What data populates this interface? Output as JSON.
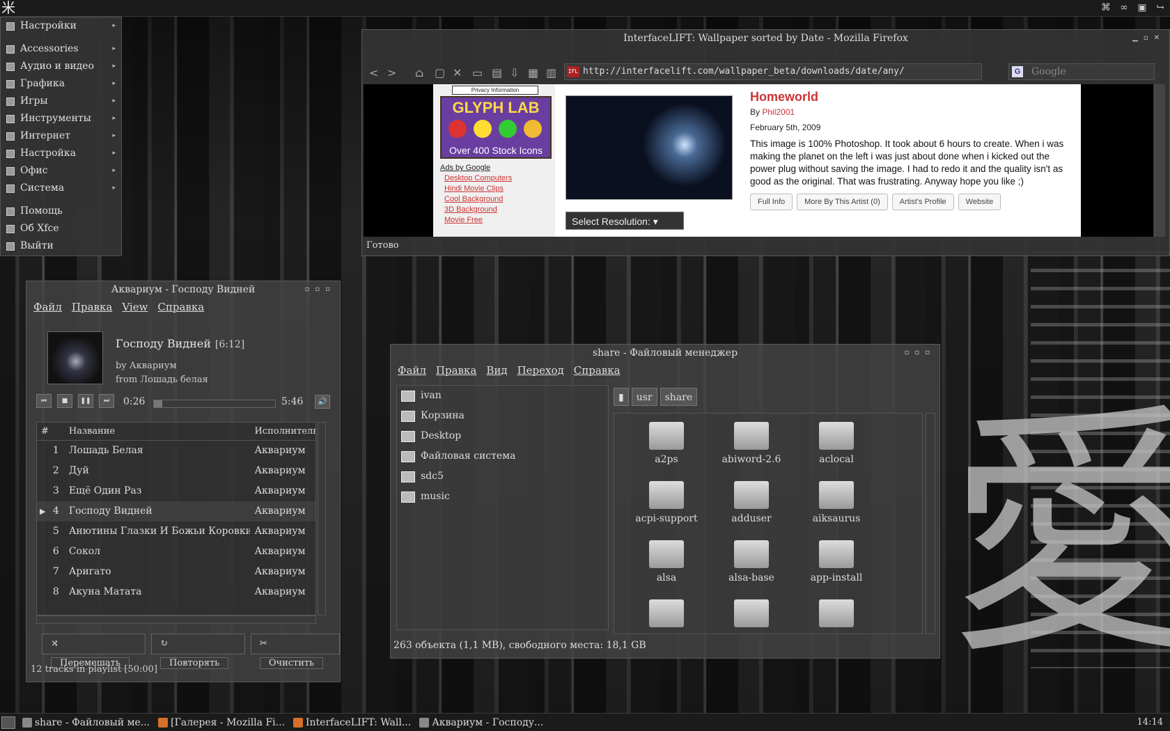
{
  "desktop": {
    "kanji": "愛"
  },
  "top_panel": {
    "logo": "米",
    "tray": [
      "⌘",
      "∞",
      "▣",
      "↪"
    ]
  },
  "app_menu": {
    "items": [
      {
        "label": "Настройки",
        "arrow": "▸"
      },
      {
        "label": "Accessories",
        "arrow": "▸"
      },
      {
        "label": "Аудио и видео",
        "arrow": "▸"
      },
      {
        "label": "Графика",
        "arrow": "▸"
      },
      {
        "label": "Игры",
        "arrow": "▸"
      },
      {
        "label": "Инструменты",
        "arrow": "▸"
      },
      {
        "label": "Интернет",
        "arrow": "▸"
      },
      {
        "label": "Настройка",
        "arrow": "▸"
      },
      {
        "label": "Офис",
        "arrow": "▸"
      },
      {
        "label": "Система",
        "arrow": "▸"
      },
      {
        "label": "Помощь",
        "arrow": ""
      },
      {
        "label": "Об Xfce",
        "arrow": ""
      },
      {
        "label": "Выйти",
        "arrow": ""
      }
    ]
  },
  "firefox": {
    "title": "InterfaceLIFT: Wallpaper sorted by Date - Mozilla Firefox",
    "url": "http://interfacelift.com/wallpaper_beta/downloads/date/any/",
    "url_favicon": "IFL",
    "search_placeholder": "Google",
    "search_engine_icon": "G",
    "status": "Готово",
    "page": {
      "privacy": "Privacy Information",
      "ad_title": "GLYPH LAB",
      "ad_subtitle": "Over 400 Stock Icons",
      "ads_by": "Ads by Google",
      "ad_links": [
        "Desktop Computers",
        "Hindi Movie Clips",
        "Cool Background",
        "3D Background",
        "Movie Free"
      ],
      "select_resolution": "Select Resolution:",
      "art_title": "Homeworld",
      "by_prefix": "By",
      "author": "Phil2001",
      "date": "February 5th, 2009",
      "description": "This image is 100% Photoshop. It took about 6 hours to create. When i was making the planet on the left i was just about done when i kicked out the power plug without saving the image. I had to redo it and the quality isn't as good as the original. That was frustrating. Anyway hope you like ;)",
      "buttons": [
        "Full Info",
        "More By This Artist (0)",
        "Artist's Profile",
        "Website"
      ]
    }
  },
  "audacious": {
    "title": "Аквариум - Господу Видней",
    "menu": [
      "Файл",
      "Правка",
      "View",
      "Справка"
    ],
    "song_title": "Господу Видней",
    "song_length": "[6:12]",
    "by": "by Аквариум",
    "from": "from Лошадь белая",
    "elapsed": "0:26",
    "total": "5:46",
    "progress": 0.07,
    "columns": [
      "#",
      "Название",
      "Исполнитель"
    ],
    "playing_marker": "▶",
    "tracks": [
      {
        "n": "1",
        "title": "Лошадь Белая",
        "artist": "Аквариум"
      },
      {
        "n": "2",
        "title": "Дуй",
        "artist": "Аквариум"
      },
      {
        "n": "3",
        "title": "Ещё Один Раз",
        "artist": "Аквариум"
      },
      {
        "n": "4",
        "title": "Господу Видней",
        "artist": "Аквариум"
      },
      {
        "n": "5",
        "title": "Анютины Глазки И Божьи Коровки",
        "artist": "Аквариум"
      },
      {
        "n": "6",
        "title": "Сокол",
        "artist": "Аквариум"
      },
      {
        "n": "7",
        "title": "Аригато",
        "artist": "Аквариум"
      },
      {
        "n": "8",
        "title": "Акуна Матата",
        "artist": "Аквариум"
      }
    ],
    "buttons": [
      "Перемешать",
      "Повторять",
      "Очистить"
    ],
    "playlist_info": "12 tracks in playlist  [50:00]"
  },
  "thunar": {
    "title": "share - Файловый менеджер",
    "menu": [
      "Файл",
      "Правка",
      "Вид",
      "Переход",
      "Справка"
    ],
    "sidebar": [
      "ivan",
      "Корзина",
      "Desktop",
      "Файловая система",
      "sdc5",
      "music"
    ],
    "path": [
      "usr",
      "share"
    ],
    "folders": [
      "a2ps",
      "abiword-2.6",
      "aclocal",
      "acpi-support",
      "adduser",
      "aiksaurus",
      "alsa",
      "alsa-base",
      "app-install",
      "",
      "",
      ""
    ],
    "status": "263 объекта (1,1 MB), свободного места: 18,1 GB"
  },
  "taskbar": {
    "tasks": [
      "share - Файловый ме...",
      "[Галерея - Mozilla Fi...",
      "InterfaceLIFT: Wall...",
      "Аквариум - Господу..."
    ],
    "clock": "14:14"
  }
}
